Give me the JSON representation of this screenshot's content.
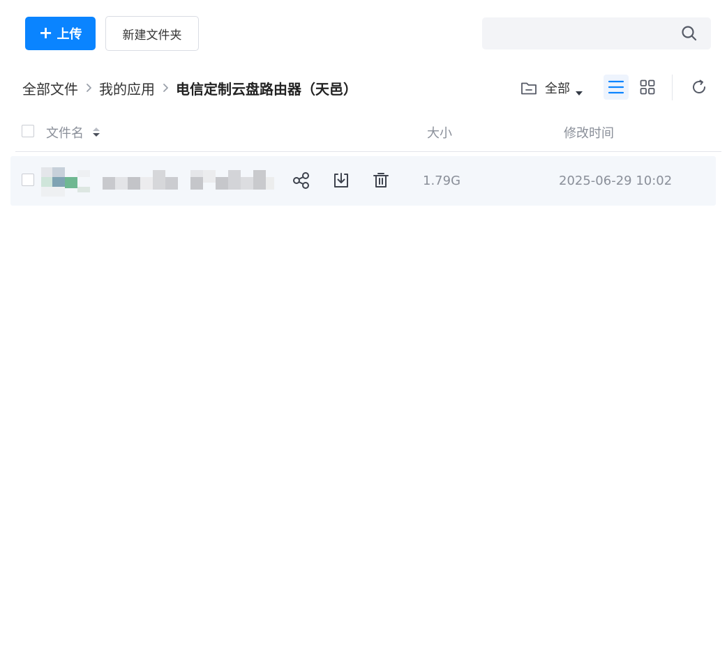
{
  "toolbar": {
    "upload_label": "上传",
    "new_folder_label": "新建文件夹",
    "search_placeholder": "",
    "search_icon": "search-icon"
  },
  "breadcrumb": {
    "items": [
      "全部文件",
      "我的应用"
    ],
    "current": "电信定制云盘路由器（天邑）"
  },
  "filter": {
    "label": "全部",
    "icon": "folder-icon"
  },
  "view": {
    "active": "list",
    "icons": [
      "list-view-icon",
      "grid-view-icon",
      "refresh-icon"
    ]
  },
  "table": {
    "columns": {
      "name": "文件名",
      "size": "大小",
      "modified": "修改时间"
    },
    "rows": [
      {
        "name": "",
        "size": "1.79G",
        "modified": "2025-06-29 10:02",
        "actions": [
          "share-icon",
          "download-icon",
          "delete-icon"
        ]
      }
    ]
  },
  "colors": {
    "accent": "#0a84ff",
    "row_bg": "#f4f7fb",
    "muted_text": "#8a8f99"
  }
}
